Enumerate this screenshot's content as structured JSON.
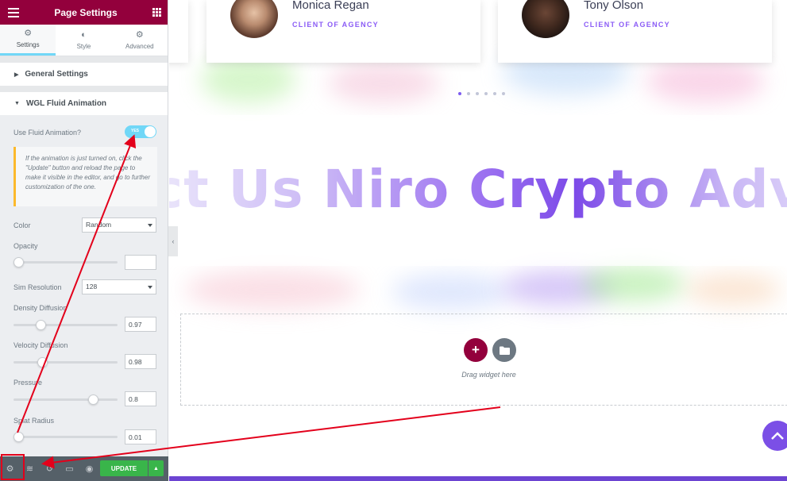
{
  "panel": {
    "title": "Page Settings",
    "tabs": [
      {
        "label": "Settings",
        "icon": "gear-icon"
      },
      {
        "label": "Style",
        "icon": "contrast-icon"
      },
      {
        "label": "Advanced",
        "icon": "gear-icon"
      }
    ],
    "sections": {
      "general": "General Settings",
      "fluid": "WGL Fluid Animation"
    },
    "controls": {
      "use_fluid_label": "Use Fluid Animation?",
      "toggle_text": "YES",
      "note": "If the animation is just turned on, click the \"Update\" button and reload the page to make it visible in the editor, and go to further customization of the one.",
      "color_label": "Color",
      "color_value": "Random",
      "opacity_label": "Opacity",
      "opacity_value": "",
      "sim_resolution_label": "Sim Resolution",
      "sim_resolution_value": "128",
      "density_label": "Density Diffusion",
      "density_value": "0.97",
      "velocity_label": "Velocity Diffusion",
      "velocity_value": "0.98",
      "pressure_label": "Pressure",
      "pressure_value": "0.8",
      "splat_label": "Splat Radius",
      "splat_value": "0.01"
    },
    "sliders": {
      "opacity": 0,
      "density": 0.24,
      "velocity": 0.25,
      "pressure": 0.8,
      "splat": 0
    },
    "footer": {
      "update_label": "UPDATE",
      "icons": [
        "gear-icon",
        "layers-icon",
        "history-icon",
        "responsive-icon",
        "eye-icon"
      ]
    }
  },
  "canvas": {
    "testimonials": [
      {
        "name": "Monica Regan",
        "role": "CLIENT OF AGENCY"
      },
      {
        "name": "Tony Olson",
        "role": "CLIENT OF AGENCY"
      }
    ],
    "carousel_dots": 6,
    "active_dot": 0,
    "marquee_text": "ct Us Niro Crypto Advis",
    "drag_hint": "Drag widget here"
  },
  "colors": {
    "brand": "#93003c",
    "accent": "#71d7f7",
    "purple": "#7b4fe6",
    "update_green": "#39b54a",
    "annotation_red": "#e3001b"
  }
}
